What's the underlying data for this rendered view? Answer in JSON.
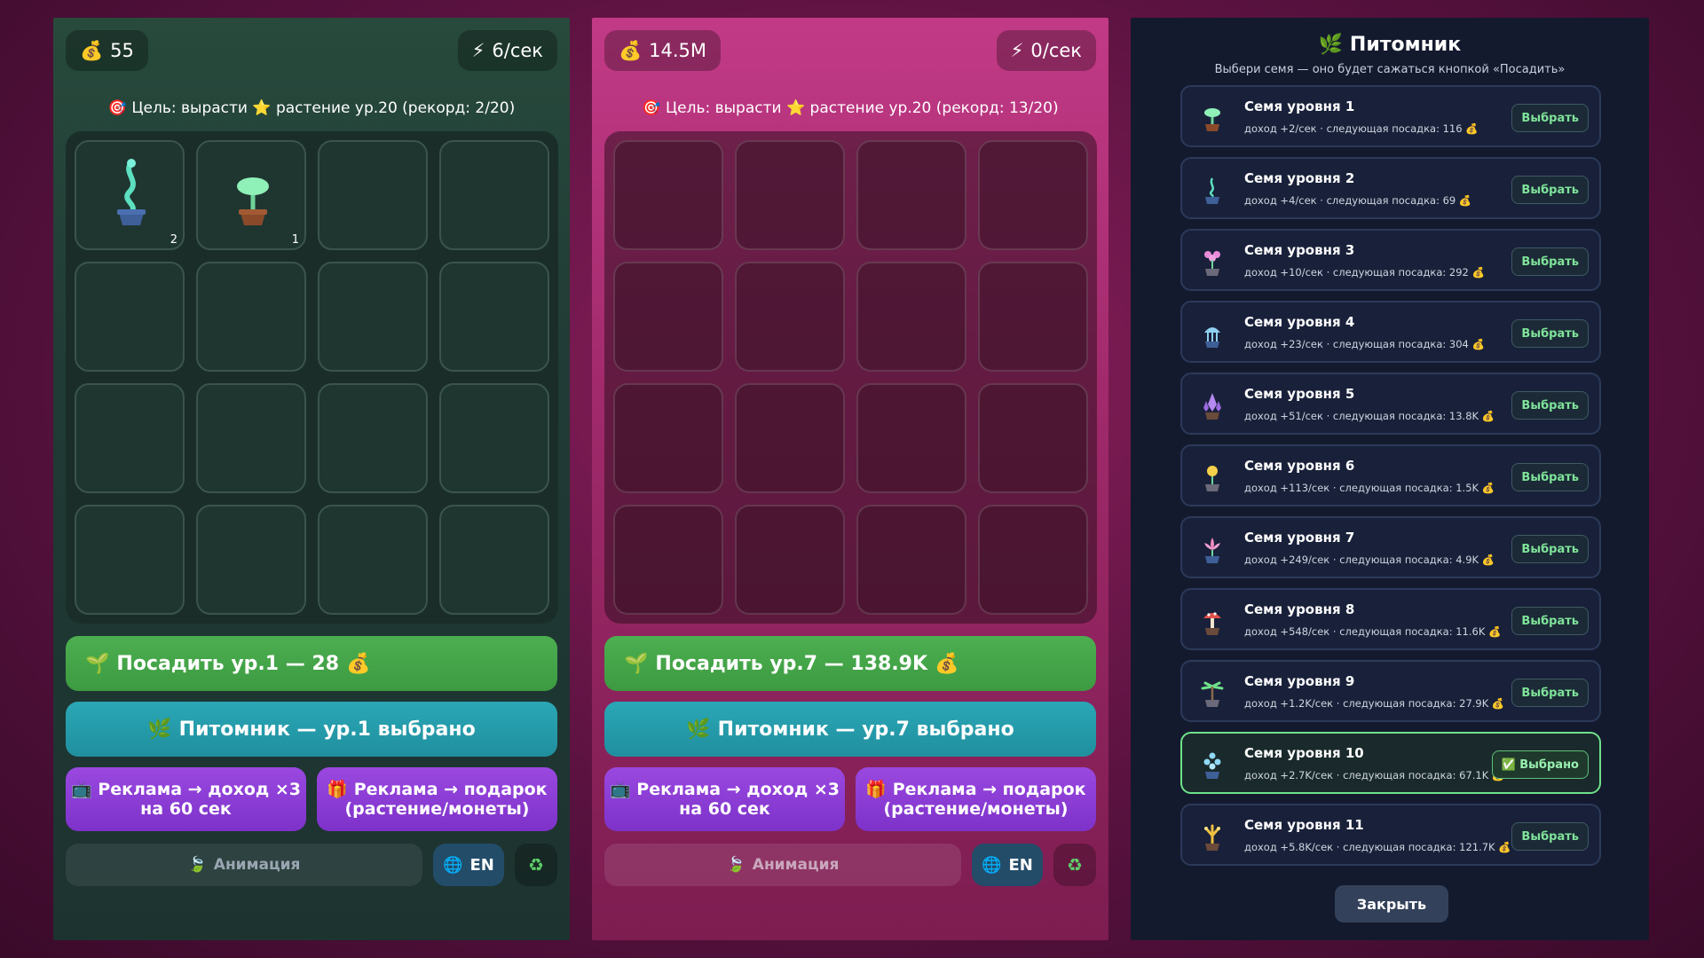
{
  "panel1": {
    "coins": "55",
    "coins_icon": "money-bag",
    "rate": "6/сек",
    "rate_icon": "lightning",
    "goal": "Цель: вырасти ⭐ растение ур.20 (рекорд: 2/20)",
    "cells": [
      {
        "plant": "sprout-vine",
        "level": "2"
      },
      {
        "plant": "sprout-leaf",
        "level": "1"
      }
    ],
    "plant_button": "Посадить ур.1 — 28",
    "nursery_button": "Питомник — ур.1 выбрано",
    "ad_income_line1": "Реклама → доход ×3",
    "ad_income_line2": "на 60 сек",
    "ad_gift_line1": "Реклама → подарок",
    "ad_gift_line2": "(растение/монеты)",
    "animation_button": "Анимация",
    "lang_button": "EN"
  },
  "panel2": {
    "coins": "14.5M",
    "rate": "0/сек",
    "goal": "Цель: вырасти ⭐ растение ур.20 (рекорд: 13/20)",
    "plant_button": "Посадить ур.7 — 138.9K",
    "nursery_button": "Питомник — ур.7 выбрано",
    "ad_income_line1": "Реклама → доход ×3",
    "ad_income_line2": "на 60 сек",
    "ad_gift_line1": "Реклама → подарок",
    "ad_gift_line2": "(растение/монеты)",
    "animation_button": "Анимация",
    "lang_button": "EN"
  },
  "nursery": {
    "title": "Питомник",
    "subtitle": "Выбери семя — оно будет сажаться кнопкой «Посадить»",
    "seeds": [
      {
        "name": "Семя уровня 1",
        "info": "доход +2/сек · следующая посадка: 116 💰",
        "button": "Выбрать",
        "icon": "sprout"
      },
      {
        "name": "Семя уровня 2",
        "info": "доход +4/сек · следующая посадка: 69 💰",
        "button": "Выбрать",
        "icon": "vine"
      },
      {
        "name": "Семя уровня 3",
        "info": "доход +10/сек · следующая посадка: 292 💰",
        "button": "Выбрать",
        "icon": "pink-flowers"
      },
      {
        "name": "Семя уровня 4",
        "info": "доход +23/сек · следующая посадка: 304 💰",
        "button": "Выбрать",
        "icon": "blue-jelly"
      },
      {
        "name": "Семя уровня 5",
        "info": "доход +51/сек · следующая посадка: 13.8K 💰",
        "button": "Выбрать",
        "icon": "crystal"
      },
      {
        "name": "Семя уровня 6",
        "info": "доход +113/сек · следующая посадка: 1.5K 💰",
        "button": "Выбрать",
        "icon": "bulb"
      },
      {
        "name": "Семя уровня 7",
        "info": "доход +249/сек · следующая посадка: 4.9K 💰",
        "button": "Выбрать",
        "icon": "lotus"
      },
      {
        "name": "Семя уровня 8",
        "info": "доход +548/сек · следующая посадка: 11.6K 💰",
        "button": "Выбрать",
        "icon": "mushroom"
      },
      {
        "name": "Семя уровня 9",
        "info": "доход +1.2K/сек · следующая посадка: 27.9K 💰",
        "button": "Выбрать",
        "icon": "palm"
      },
      {
        "name": "Семя уровня 10",
        "info": "доход +2.7K/сек · следующая посадка: 67.1K 💰",
        "button": "✅ Выбрано",
        "icon": "bubbles",
        "selected": true
      },
      {
        "name": "Семя уровня 11",
        "info": "доход +5.8K/сек · следующая посадка: 121.7K 💰",
        "button": "Выбрать",
        "icon": "golden-tree"
      }
    ],
    "close_button": "Закрыть"
  },
  "colors": {
    "plant_green": "#4caf50",
    "nursery_teal": "#2aa7b6",
    "ad_purple": "#8b3fd6",
    "selected_border": "#6ee18a"
  }
}
